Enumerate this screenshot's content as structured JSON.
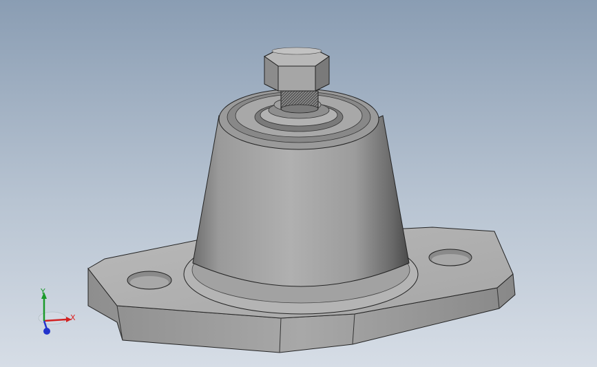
{
  "viewport": {
    "background_top": "#8a9db3",
    "background_bottom": "#d6dde6"
  },
  "model": {
    "icon": "vibration-isolator-mount-3d-model"
  },
  "triad": {
    "icon": "view-orientation-triad",
    "x_label": "X",
    "y_label": "Y",
    "x_color": "#d22222",
    "y_color": "#1a9a2a",
    "z_color": "#2233cc"
  }
}
